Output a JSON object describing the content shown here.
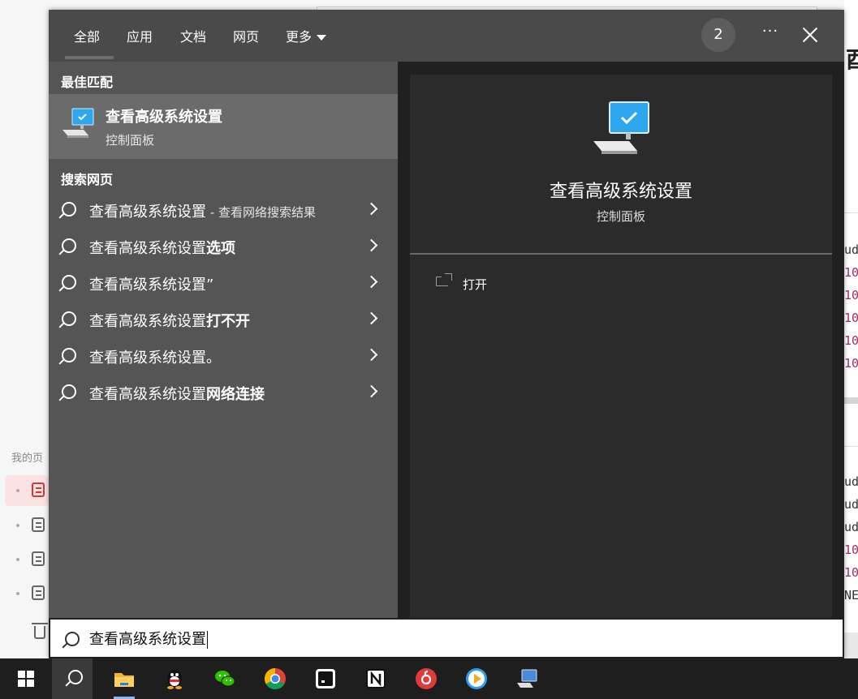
{
  "colors": {
    "panel_bg": "#202020",
    "results_bg": "#555555",
    "best_match_bg": "#6b6b6b",
    "preview_bg": "#2b2b2b",
    "tabs_bg": "#4a4a4a",
    "taskbar_bg": "#1e1e1e"
  },
  "background_app": {
    "left_section_label": "我的页",
    "right_glyph": "酉",
    "code_lines_top": [
      "ud",
      "10",
      "10",
      "10",
      "10",
      "10"
    ],
    "code_lines_bottom": [
      "ud",
      "ud",
      "ud",
      "10",
      "10",
      "NE"
    ]
  },
  "tabs": [
    {
      "label": "全部",
      "active": true
    },
    {
      "label": "应用"
    },
    {
      "label": "文档"
    },
    {
      "label": "网页"
    },
    {
      "label": "更多",
      "dropdown": true
    }
  ],
  "header": {
    "badge_count": "2",
    "more_icon": "ellipsis-icon",
    "close_icon": "close-icon"
  },
  "best_match": {
    "section_title": "最佳匹配",
    "title": "查看高级系统设置",
    "subtitle": "控制面板",
    "icon": "computer-monitor-icon"
  },
  "web_search": {
    "section_title": "搜索网页",
    "items": [
      {
        "base": "查看高级系统设置",
        "suffix": "",
        "sub": " - 查看网络搜索结果"
      },
      {
        "base": "查看高级系统设置",
        "suffix": "选项",
        "sub": ""
      },
      {
        "base": "查看高级系统设置”",
        "suffix": "",
        "sub": ""
      },
      {
        "base": "查看高级系统设置",
        "suffix": "打不开",
        "sub": ""
      },
      {
        "base": "查看高级系统设置。",
        "suffix": "",
        "sub": ""
      },
      {
        "base": "查看高级系统设置",
        "suffix": "网络连接",
        "sub": ""
      }
    ]
  },
  "preview": {
    "title": "查看高级系统设置",
    "subtitle": "控制面板",
    "actions": [
      {
        "label": "打开",
        "icon": "open-icon"
      }
    ]
  },
  "search": {
    "value": "查看高级系统设置",
    "icon": "search-icon"
  },
  "taskbar": {
    "items": [
      {
        "name": "start-button",
        "icon": "windows-icon"
      },
      {
        "name": "search-button",
        "icon": "search-icon",
        "active": true
      },
      {
        "name": "file-explorer",
        "icon": "folder-icon",
        "color": "#f2b632"
      },
      {
        "name": "qq",
        "icon": "penguin-icon",
        "color": "#111111"
      },
      {
        "name": "wechat",
        "icon": "wechat-icon",
        "color": "#2dc100"
      },
      {
        "name": "chrome",
        "icon": "chrome-icon",
        "color": "#db4437"
      },
      {
        "name": "terminal-app",
        "icon": "terminal-icon",
        "color": "#ffffff"
      },
      {
        "name": "notion",
        "icon": "notion-icon",
        "color": "#ffffff"
      },
      {
        "name": "netease-music",
        "icon": "music-icon",
        "color": "#e03b3b"
      },
      {
        "name": "video-player",
        "icon": "play-icon",
        "color": "#2a9df4"
      },
      {
        "name": "remote-desktop",
        "icon": "monitor-icon",
        "color": "#4a8ad8"
      }
    ]
  }
}
